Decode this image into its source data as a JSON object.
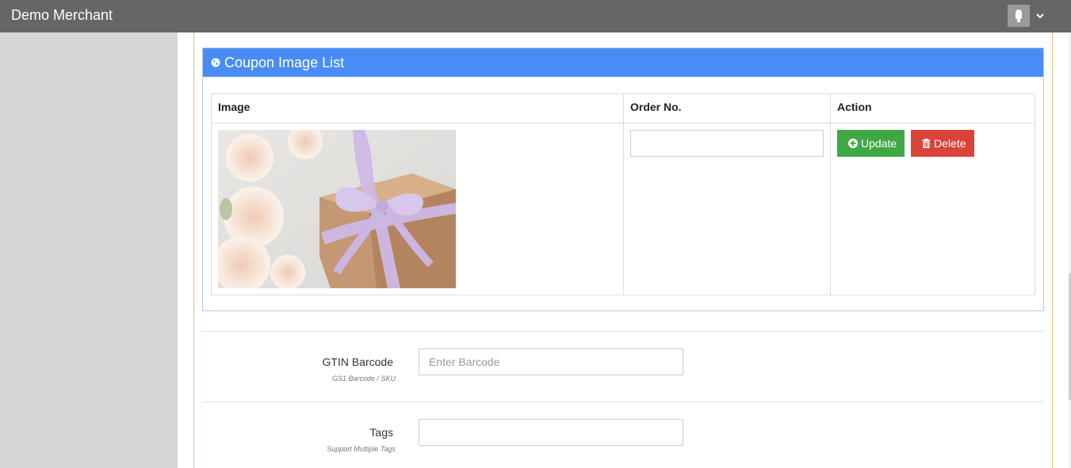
{
  "header": {
    "brand": "Demo Merchant"
  },
  "panel": {
    "title": "Coupon Image List",
    "columns": [
      "Image",
      "Order No.",
      "Action"
    ],
    "row": {
      "order_no": "",
      "update_label": "Update",
      "delete_label": "Delete"
    }
  },
  "form": {
    "gtin": {
      "label": "GTIN Barcode",
      "hint": "GS1 Barcode / SKU",
      "placeholder": "Enter Barcode",
      "value": ""
    },
    "tags": {
      "label": "Tags",
      "hint": "Support Multiple Tags",
      "placeholder": "",
      "value": ""
    }
  },
  "colors": {
    "topbar": "#666666",
    "panel_header": "#4a8cf7",
    "update_button": "#3fa845",
    "delete_button": "#d9443a"
  },
  "icons": {
    "user": "key-icon",
    "menu": "chevron-down-icon",
    "panel": "globe-icon",
    "update": "plus-circle-icon",
    "delete": "trash-icon"
  }
}
